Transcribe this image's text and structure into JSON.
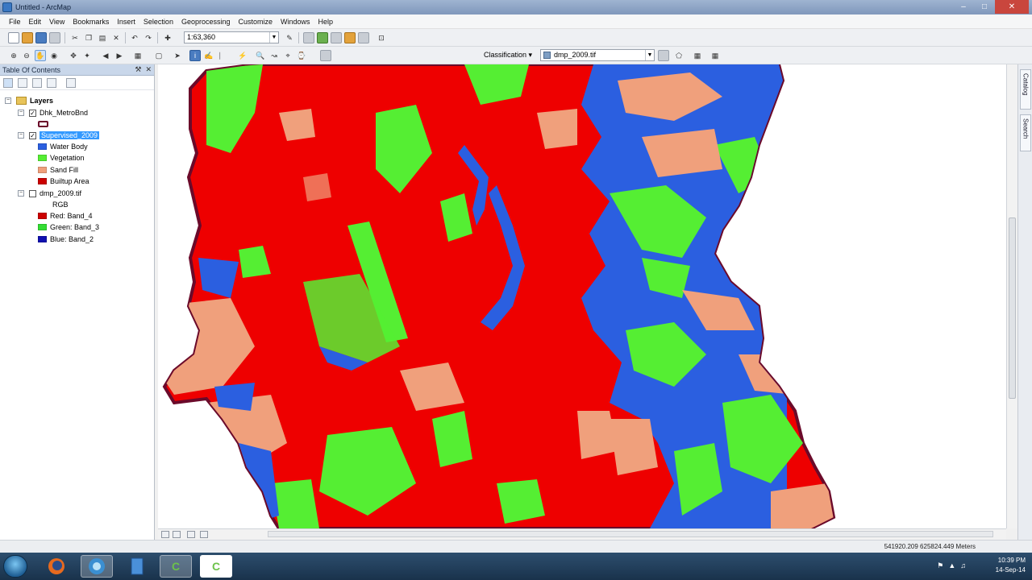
{
  "window": {
    "title": "Untitled - ArcMap"
  },
  "menu": [
    "File",
    "Edit",
    "View",
    "Bookmarks",
    "Insert",
    "Selection",
    "Geoprocessing",
    "Customize",
    "Windows",
    "Help"
  ],
  "toolbar": {
    "scale": "1:63,360",
    "classification_label": "Classification ▾",
    "classification_layer": "dmp_2009.tif"
  },
  "toc": {
    "title": "Table Of Contents",
    "root": "Layers",
    "layers": [
      {
        "name": "Dhk_MetroBnd"
      },
      {
        "name": "Supervised_2009",
        "classes": [
          "Water Body",
          "Vegetation",
          "Sand Fill",
          "Builtup Area"
        ]
      },
      {
        "name": "dmp_2009.tif",
        "composite": "RGB",
        "bands": [
          "Red:   Band_4",
          "Green: Band_3",
          "Blue:  Band_2"
        ]
      }
    ]
  },
  "colors": {
    "water": "#2b5fe0",
    "vegetation": "#55ee33",
    "sand": "#f0a07c",
    "builtup": "#ee0000",
    "red_band": "#cc0000",
    "green_band": "#33dd33",
    "blue_band": "#1010b0",
    "boundary": "#6b0a2a"
  },
  "side_tabs": [
    "Catalog",
    "Search"
  ],
  "status": {
    "coords": "541920.209  625824.449 Meters"
  },
  "tray": {
    "time": "10:39 PM",
    "date": "14-Sep-14"
  },
  "taskbar": {
    "icons": [
      "windows-start",
      "firefox",
      "arcmap",
      "file",
      "camtasia",
      "camtasia-recorder"
    ]
  }
}
